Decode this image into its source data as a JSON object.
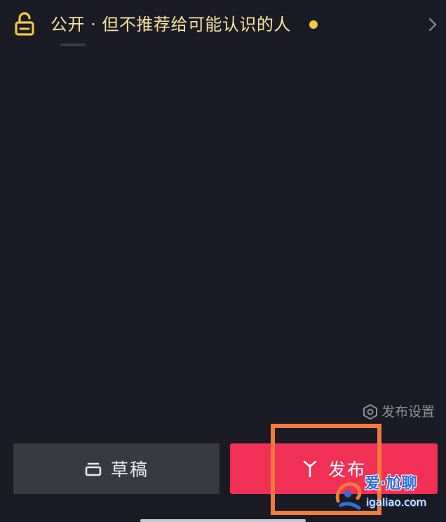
{
  "privacy": {
    "label": "公开 · 但不推荐给可能认识的人",
    "lock_icon": "unlock-icon",
    "chevron_icon": "chevron-right-icon",
    "dot_color": "#f5c842",
    "text_color": "#f7e3a3"
  },
  "settings": {
    "label": "发布设置",
    "icon": "hexagon-settings-icon"
  },
  "actions": {
    "draft_label": "草稿",
    "draft_icon": "draft-box-icon",
    "publish_label": "发布",
    "publish_icon": "publish-sparkle-icon",
    "publish_color": "#f13055"
  },
  "watermark": {
    "title": "爱·尬聊",
    "url": "igaliao.com"
  }
}
